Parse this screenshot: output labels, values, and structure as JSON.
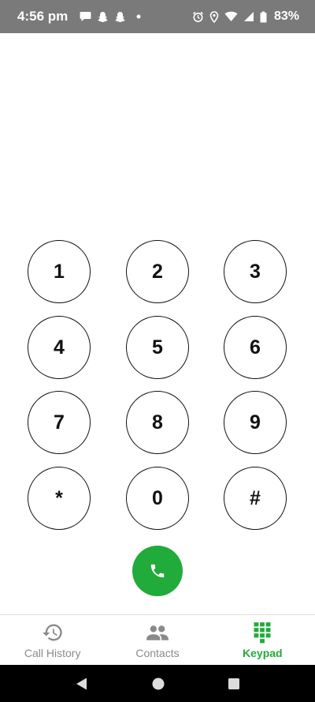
{
  "status_bar": {
    "time": "4:56 pm",
    "battery": "83%",
    "left_icons": [
      "chat-bubble-icon",
      "snapchat-icon",
      "snapchat-icon",
      "dot-icon"
    ],
    "right_icons": [
      "alarm-icon",
      "location-icon",
      "wifi-icon",
      "signal-icon",
      "battery-icon"
    ]
  },
  "keypad": {
    "keys": [
      "1",
      "2",
      "3",
      "4",
      "5",
      "6",
      "7",
      "8",
      "9",
      "*",
      "0",
      "#"
    ]
  },
  "call_button": {
    "icon": "phone-icon",
    "color": "#20ab3a"
  },
  "bottom_nav": {
    "items": [
      {
        "label": "Call History",
        "icon": "history-icon",
        "active": false
      },
      {
        "label": "Contacts",
        "icon": "contacts-icon",
        "active": false
      },
      {
        "label": "Keypad",
        "icon": "keypad-grid-icon",
        "active": true
      }
    ],
    "active_color": "#20ab3a",
    "inactive_color": "#8a8a8a"
  },
  "system_nav": {
    "icons": [
      "back-icon",
      "home-icon",
      "recents-icon"
    ]
  }
}
